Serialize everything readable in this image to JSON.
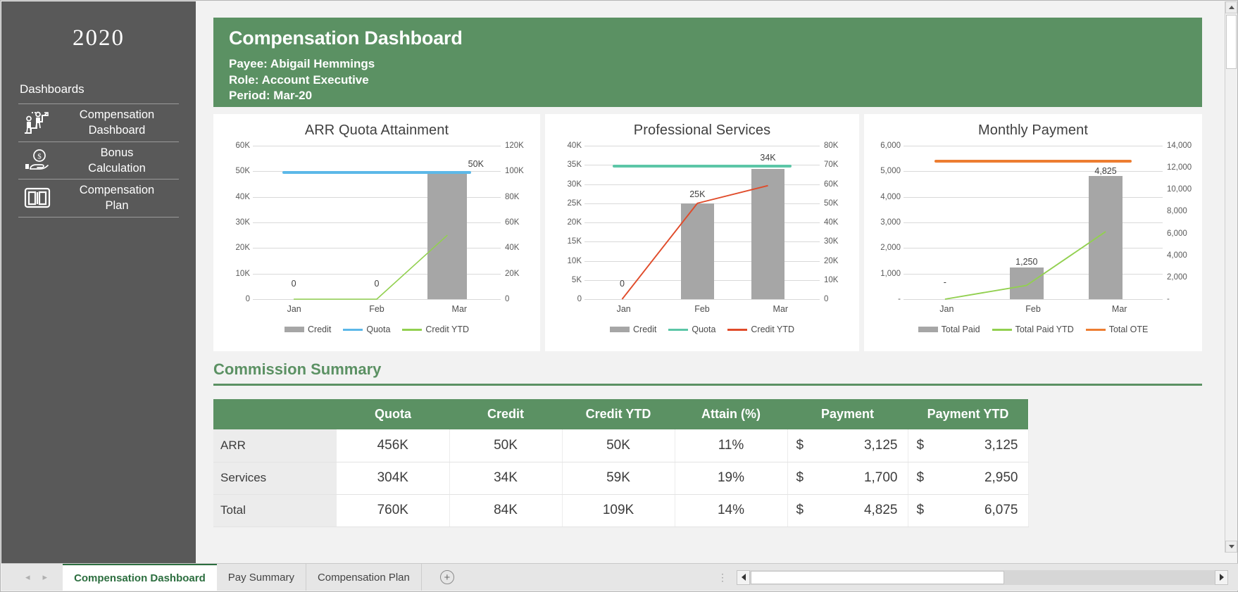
{
  "sidebar": {
    "year": "2020",
    "section_label": "Dashboards",
    "items": [
      {
        "label": "Compensation\nDashboard",
        "label_line1": "Compensation",
        "label_line2": "Dashboard",
        "icon": "people-growth-icon"
      },
      {
        "label": "Bonus Calculation",
        "label_line1": "Bonus",
        "label_line2": "Calculation",
        "icon": "hand-coin-icon"
      },
      {
        "label": "Compensation Plan",
        "label_line1": "Compensation",
        "label_line2": "Plan",
        "icon": "open-book-icon"
      }
    ]
  },
  "banner": {
    "title": "Compensation Dashboard",
    "payee": "Payee: Abigail Hemmings",
    "role": "Role: Account Executive",
    "period": "Period: Mar-20",
    "bg_color": "#5b9163"
  },
  "chart_data": [
    {
      "id": "arr-quota-attainment",
      "type": "bar",
      "title": "ARR Quota Attainment",
      "categories": [
        "Jan",
        "Feb",
        "Mar"
      ],
      "series": [
        {
          "name": "Credit",
          "type": "bar",
          "color": "#a6a6a6",
          "axis": "left",
          "values": [
            0,
            0,
            50000
          ]
        },
        {
          "name": "Quota",
          "type": "line",
          "color": "#5cb8e8",
          "axis": "left",
          "values": [
            50000,
            50000,
            50000
          ]
        },
        {
          "name": "Credit YTD",
          "type": "line",
          "color": "#92d050",
          "axis": "right",
          "values": [
            0,
            0,
            50000
          ]
        }
      ],
      "data_labels": [
        "0",
        "0",
        "50K"
      ],
      "quota_label": "50K",
      "ylabel": "",
      "xlabel": "",
      "ylim": [
        0,
        60000
      ],
      "y2lim": [
        0,
        120000
      ],
      "yticks": [
        "0",
        "10K",
        "20K",
        "30K",
        "40K",
        "50K",
        "60K"
      ],
      "y2ticks": [
        "0",
        "20K",
        "40K",
        "60K",
        "80K",
        "100K",
        "120K"
      ],
      "grid": true,
      "legend_position": "bottom"
    },
    {
      "id": "professional-services",
      "type": "bar",
      "title": "Professional Services",
      "categories": [
        "Jan",
        "Feb",
        "Mar"
      ],
      "series": [
        {
          "name": "Credit",
          "type": "bar",
          "color": "#a6a6a6",
          "axis": "left",
          "values": [
            0,
            25000,
            34000
          ]
        },
        {
          "name": "Quota",
          "type": "line",
          "color": "#5cc6a7",
          "axis": "left",
          "values": [
            35000,
            35000,
            35000
          ]
        },
        {
          "name": "Credit YTD",
          "type": "line",
          "color": "#e04b2a",
          "axis": "right",
          "values": [
            0,
            25000,
            59000
          ]
        }
      ],
      "data_labels": [
        "0",
        "25K",
        "34K"
      ],
      "quota_label": "34K",
      "ylabel": "",
      "xlabel": "",
      "ylim": [
        0,
        40000
      ],
      "y2lim": [
        0,
        80000
      ],
      "yticks": [
        "0",
        "5K",
        "10K",
        "15K",
        "20K",
        "25K",
        "30K",
        "35K",
        "40K"
      ],
      "y2ticks": [
        "0",
        "10K",
        "20K",
        "30K",
        "40K",
        "50K",
        "60K",
        "70K",
        "80K"
      ],
      "grid": true,
      "legend_position": "bottom"
    },
    {
      "id": "monthly-payment",
      "type": "bar",
      "title": "Monthly Payment",
      "categories": [
        "Jan",
        "Feb",
        "Mar"
      ],
      "series": [
        {
          "name": "Total Paid",
          "type": "bar",
          "color": "#a6a6a6",
          "axis": "left",
          "values": [
            0,
            1250,
            4825
          ]
        },
        {
          "name": "Total Paid YTD",
          "type": "line",
          "color": "#92d050",
          "axis": "right",
          "values": [
            0,
            1250,
            6075
          ]
        },
        {
          "name": "Total OTE",
          "type": "line",
          "color": "#ed7d31",
          "axis": "left",
          "values": [
            5450,
            5450,
            5450
          ]
        }
      ],
      "data_labels": [
        "-",
        "1,250",
        "4,825"
      ],
      "ylabel": "",
      "xlabel": "",
      "ylim": [
        0,
        6000
      ],
      "y2lim": [
        0,
        14000
      ],
      "yticks": [
        "-",
        "1,000",
        "2,000",
        "3,000",
        "4,000",
        "5,000",
        "6,000"
      ],
      "y2ticks": [
        "-",
        "2,000",
        "4,000",
        "6,000",
        "8,000",
        "10,000",
        "12,000",
        "14,000"
      ],
      "grid": true,
      "legend_position": "bottom"
    }
  ],
  "summary": {
    "title": "Commission Summary",
    "headers": [
      "",
      "Quota",
      "Credit",
      "Credit YTD",
      "Attain (%)",
      "Payment",
      "Payment YTD"
    ],
    "rows": [
      {
        "label": "ARR",
        "quota": "456K",
        "credit": "50K",
        "credit_ytd": "50K",
        "attain": "11%",
        "payment_cur": "$",
        "payment": "3,125",
        "payment_ytd_cur": "$",
        "payment_ytd": "3,125"
      },
      {
        "label": "Services",
        "quota": "304K",
        "credit": "34K",
        "credit_ytd": "59K",
        "attain": "19%",
        "payment_cur": "$",
        "payment": "1,700",
        "payment_ytd_cur": "$",
        "payment_ytd": "2,950"
      },
      {
        "label": "Total",
        "quota": "760K",
        "credit": "84K",
        "credit_ytd": "109K",
        "attain": "14%",
        "payment_cur": "$",
        "payment": "4,825",
        "payment_ytd_cur": "$",
        "payment_ytd": "6,075"
      }
    ]
  },
  "sheet_tabs": {
    "tabs": [
      {
        "label": "Compensation Dashboard",
        "active": true
      },
      {
        "label": "Pay Summary",
        "active": false
      },
      {
        "label": "Compensation Plan",
        "active": false
      }
    ],
    "add_label": "+",
    "prev_label": "◂",
    "next_label": "▸"
  }
}
